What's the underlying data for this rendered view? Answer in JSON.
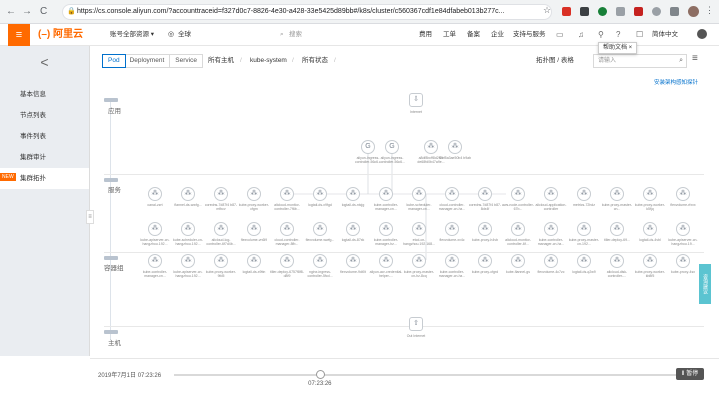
{
  "browser": {
    "url": "https://cs.console.aliyun.com/?accounttraceid=f327d0c7-8826-4e30-a428-33e5425d89bb#/k8s/cluster/c560367cdf1e84dfabeb013b277c...",
    "back": "←",
    "forward": "→",
    "reload": "C"
  },
  "topbar": {
    "logo": "(–) 阿里云",
    "account": "账号全部资源 ▾",
    "region": "全球",
    "search_placeholder": "搜索",
    "items": [
      "费用",
      "工单",
      "备案",
      "企业",
      "支持与服务"
    ],
    "lang": "简体中文"
  },
  "sidebar": {
    "back": "<",
    "items": [
      {
        "label": "基本信息",
        "active": false
      },
      {
        "label": "节点列表",
        "active": false
      },
      {
        "label": "事件列表",
        "active": false
      },
      {
        "label": "集群审计",
        "active": false
      },
      {
        "label": "集群拓扑",
        "active": true
      }
    ],
    "new_badge": "NEW"
  },
  "filterbar": {
    "tabs": [
      "Pod",
      "Deployment",
      "Service"
    ],
    "active_tab": "Pod",
    "crumbs": [
      "所有主机",
      "kube-system",
      "所有状态"
    ],
    "view": "拓扑图 / 表格",
    "search_placeholder": "请输入",
    "tooltip": "帮助文档 ×",
    "install_link": "安装架构感知探针"
  },
  "topology": {
    "layers": [
      "应用",
      "服务",
      "容器组",
      "主机"
    ],
    "top_node": "Internet",
    "bottom_node": "Out Internet",
    "service_nodes": [
      "aliyun-ingress-controller-56c6...",
      "aliyun-ingress-controller-56c6...",
      "a8df8bcff8d2f7c de68fd0b47a9e...",
      "f8bf5a3ae50b4 b9ab"
    ],
    "pod_row1": [
      "canal-zzrt",
      "flannel-ds-wwfg...",
      "coredns-7d87f4 b87-mfbcv",
      "kube-proxy-worker-cfgm",
      "alicloud-monitor-controller-7f6b...",
      "logtail-ds-x9fgd",
      "logtail-ds-ntcjg",
      "kube-controller-manager-cn...",
      "kube-scheduler-manager-cn...",
      "cloud-controller-manager-cn-hz...",
      "coredns-7d87f4 b87-8dx4f",
      "aws-node-controller-67b...",
      "alicloud-application-controller",
      "metrics-72hdz",
      "kube-proxy-master-cn...",
      "kube-proxy-worker-k5fjq",
      "flexvolume-rfxxx"
    ],
    "pod_row2": [
      "kube-apiserver-cn-hangzhou.192...",
      "kube-scheduler-cn-hangzhou.192...",
      "alicloud-log-controller-6f7d4b...",
      "flexvolume-vn6l9",
      "cloud-controller-manager-8fb...",
      "flexvolume-wwfg...",
      "logtail-ds-87xk",
      "kube-controller-manager-hz...",
      "etcd-cn-hangzhou.192.168...",
      "flexvolume-xv4c",
      "kube-proxy-h4vb",
      "alicloud-monitor-controller-6f...",
      "kube-controller-manager-cn-hz...",
      "kube-proxy-master-cn-192...",
      "tiller-deploy-69...",
      "logtail-ds-4vbl",
      "kube-apiserver-cn-hangzhou.19..."
    ],
    "pod_row3": [
      "kube-controller-manager-cn...",
      "kube-apiserver-cn-hangzhou.192...",
      "kube-proxy-worker-9fd5",
      "logtail-ds-x9ttn",
      "tiller-deploy-6757f8f8-d8f9",
      "nginx-ingress-controller-5fcd...",
      "flexvolume-9dt0t",
      "aliyun-acr-credential-helper-...",
      "kube-proxy-master-cn-hz-8cq",
      "kube-controller-manager-cn-hz...",
      "kube-proxy-cfgrd",
      "kube-flannel-gs",
      "flexvolume-4c7zc",
      "logtail-ds-q2w9",
      "alicloud-disk-controller-...",
      "kube-proxy-worker-kb8f5",
      "kube-proxy-4sx"
    ]
  },
  "timeline": {
    "date": "2019年7月1日 07:23:26",
    "knob_time": "07:23:26",
    "pause_label": "暂停",
    "position": 0.29
  },
  "feedback_label": "咨询建议"
}
